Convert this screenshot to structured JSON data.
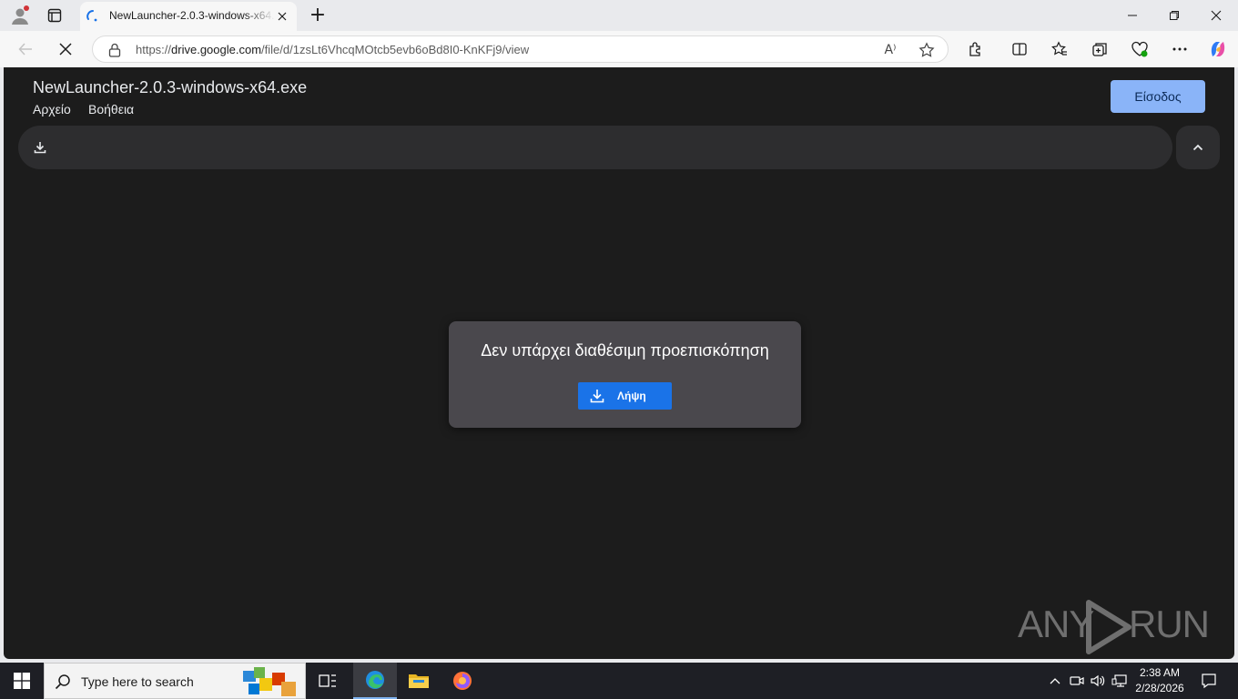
{
  "browser": {
    "tab": {
      "title": "NewLauncher-2.0.3-windows-x64.exe"
    },
    "new_tab_symbol": "+",
    "address": {
      "scheme": "https://",
      "host": "drive.google.com",
      "path": "/file/d/1zsLt6VhcqMOtcb5evb6oBd8I0-KnKFj9/view"
    },
    "read_aloud_label": "A⁾",
    "colors": {
      "frame": "#e9eaed",
      "toolbar": "#f7f7f7"
    }
  },
  "page": {
    "file_title": "NewLauncher-2.0.3-windows-x64.exe",
    "menu": {
      "file": "Αρχείο",
      "help": "Βοήθεια"
    },
    "signin_label": "Είσοδος",
    "no_preview_message": "Δεν υπάρχει διαθέσιμη προεπισκόπηση",
    "download_button_label": "Λήψη",
    "watermark": {
      "left": "ANY",
      "right": "RUN"
    },
    "colors": {
      "background": "#1c1c1c",
      "accent": "#8ab4f8",
      "button": "#1a73e8",
      "card": "#4a484d"
    }
  },
  "taskbar": {
    "search_placeholder": "Type here to search",
    "clock": {
      "time": "2:38 AM",
      "date": "2/28/2026"
    }
  }
}
